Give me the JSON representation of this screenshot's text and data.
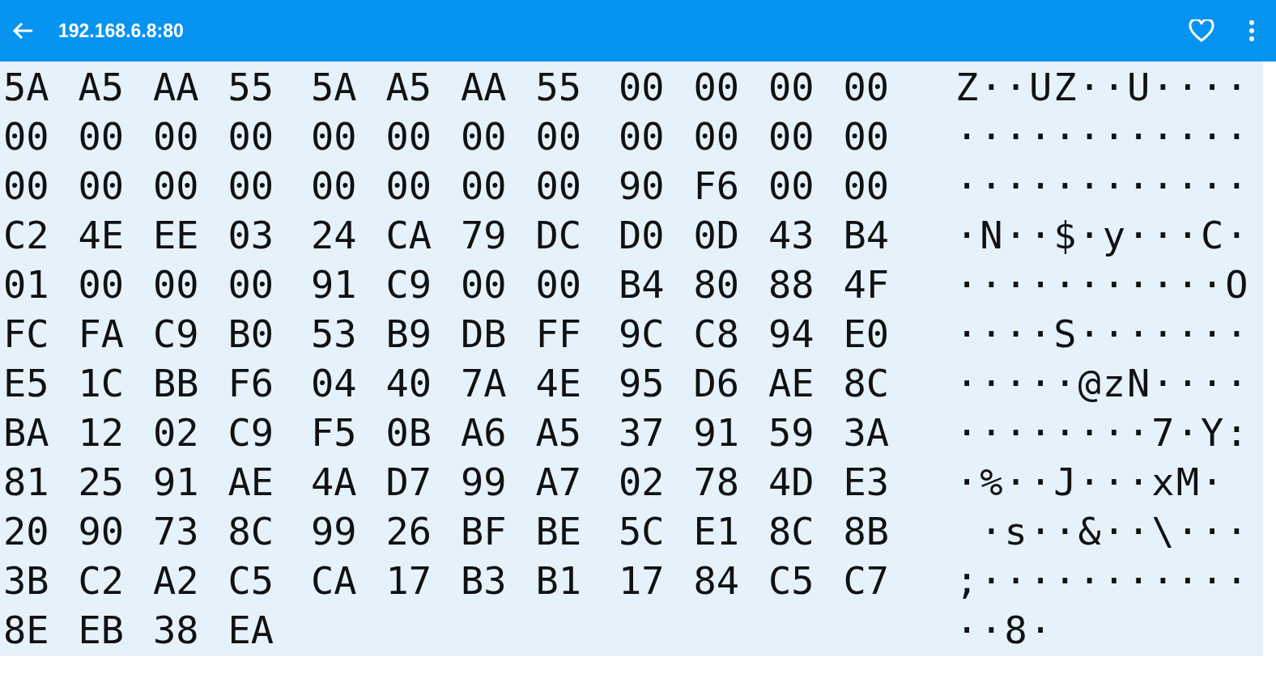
{
  "app_bar": {
    "title": "192.168.6.8:80"
  },
  "rows": [
    {
      "bytes": [
        "5A",
        "A5",
        "AA",
        "55",
        "5A",
        "A5",
        "AA",
        "55",
        "00",
        "00",
        "00",
        "00"
      ],
      "ascii": "Z··UZ··U····"
    },
    {
      "bytes": [
        "00",
        "00",
        "00",
        "00",
        "00",
        "00",
        "00",
        "00",
        "00",
        "00",
        "00",
        "00"
      ],
      "ascii": "············"
    },
    {
      "bytes": [
        "00",
        "00",
        "00",
        "00",
        "00",
        "00",
        "00",
        "00",
        "90",
        "F6",
        "00",
        "00"
      ],
      "ascii": "············"
    },
    {
      "bytes": [
        "C2",
        "4E",
        "EE",
        "03",
        "24",
        "CA",
        "79",
        "DC",
        "D0",
        "0D",
        "43",
        "B4"
      ],
      "ascii": "·N··$·y···C·"
    },
    {
      "bytes": [
        "01",
        "00",
        "00",
        "00",
        "91",
        "C9",
        "00",
        "00",
        "B4",
        "80",
        "88",
        "4F"
      ],
      "ascii": "···········O"
    },
    {
      "bytes": [
        "FC",
        "FA",
        "C9",
        "B0",
        "53",
        "B9",
        "DB",
        "FF",
        "9C",
        "C8",
        "94",
        "E0"
      ],
      "ascii": "····S·······"
    },
    {
      "bytes": [
        "E5",
        "1C",
        "BB",
        "F6",
        "04",
        "40",
        "7A",
        "4E",
        "95",
        "D6",
        "AE",
        "8C"
      ],
      "ascii": "·····@zN····"
    },
    {
      "bytes": [
        "BA",
        "12",
        "02",
        "C9",
        "F5",
        "0B",
        "A6",
        "A5",
        "37",
        "91",
        "59",
        "3A"
      ],
      "ascii": "········7·Y:"
    },
    {
      "bytes": [
        "81",
        "25",
        "91",
        "AE",
        "4A",
        "D7",
        "99",
        "A7",
        "02",
        "78",
        "4D",
        "E3"
      ],
      "ascii": "·%··J···xM·"
    },
    {
      "bytes": [
        "20",
        "90",
        "73",
        "8C",
        "99",
        "26",
        "BF",
        "BE",
        "5C",
        "E1",
        "8C",
        "8B"
      ],
      "ascii": " ·s··&··\\···"
    },
    {
      "bytes": [
        "3B",
        "C2",
        "A2",
        "C5",
        "CA",
        "17",
        "B3",
        "B1",
        "17",
        "84",
        "C5",
        "C7"
      ],
      "ascii": ";···········"
    },
    {
      "bytes": [
        "8E",
        "EB",
        "38",
        "EA"
      ],
      "ascii": "··8·"
    }
  ]
}
